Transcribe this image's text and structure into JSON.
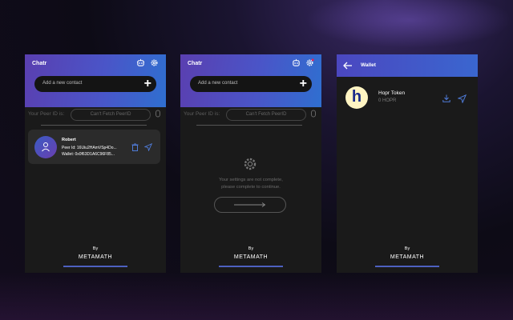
{
  "chat_panel": {
    "title": "Chatr",
    "search_placeholder": "Add a new contact",
    "add_glyph": "+",
    "peer_label": "Your Peer ID is:",
    "peer_value": "Can't Fetch PeerID",
    "contact": {
      "name": "Robert",
      "peer_line": "Peer Id: 16Uiu2HAmVSp4Do...",
      "wallet_line": "Wallet: 0x0f63D1A6C96F85..."
    },
    "footer_by": "By",
    "footer_logo": "METAMATH"
  },
  "settings_panel": {
    "title": "Chatr",
    "search_placeholder": "Add a new contact",
    "add_glyph": "+",
    "peer_label": "Your Peer ID is:",
    "peer_value": "Can't Fetch PeerID",
    "message_line1": "Your settings are not complete,",
    "message_line2": "please complete to continue.",
    "footer_by": "By",
    "footer_logo": "METAMATH"
  },
  "wallet_panel": {
    "title": "Wallet",
    "token_name": "Hopr Token",
    "token_balance": "0 HOPR",
    "token_logo_glyph": "h",
    "footer_by": "By",
    "footer_logo": "METAMATH"
  },
  "icons": [
    "robot-icon",
    "gear-icon",
    "copy-icon",
    "user-icon",
    "trash-icon",
    "send-icon",
    "arrow-right-icon",
    "back-arrow-icon",
    "download-icon"
  ],
  "colors": {
    "accent": "#4a55c8",
    "panel": "#1a1a1a",
    "send": "#4f7bd8"
  }
}
